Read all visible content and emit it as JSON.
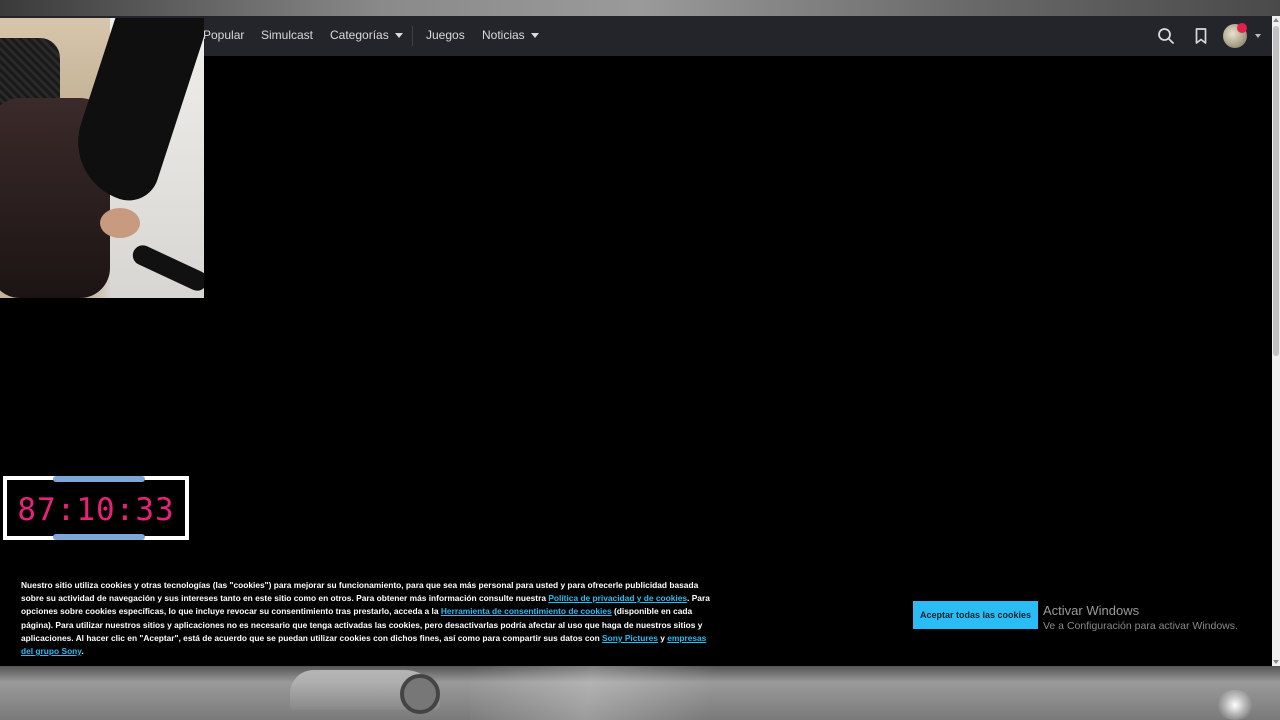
{
  "nav": {
    "items": [
      {
        "label": "Popular"
      },
      {
        "label": "Simulcast"
      },
      {
        "label": "Categorías"
      },
      {
        "label": "Juegos"
      },
      {
        "label": "Noticias"
      }
    ],
    "icons": [
      "search-icon",
      "bookmark-icon",
      "avatar"
    ]
  },
  "timer": {
    "display": "87:10:33"
  },
  "cookie_banner": {
    "text_1": "Nuestro sitio utiliza cookies y otras tecnologías (las \"cookies\") para mejorar su funcionamiento, para que sea más personal para usted y para ofrecerle publicidad basada sobre su actividad de navegación y sus intereses tanto en este sitio como en otros. Para obtener más información consulte nuestra ",
    "link_privacy": "Política de privacidad y de cookies",
    "text_2": ". Para opciones sobre cookies específicas, lo que incluye revocar su consentimiento tras prestarlo, acceda a la ",
    "link_tool": "Herramienta de consentimiento de cookies",
    "text_3": " (disponible en cada página). Para utilizar nuestros sitios y aplicaciones no es necesario que tenga activadas las cookies, pero desactivarlas podría afectar al uso que haga de nuestros sitios y aplicaciones. Al hacer clic en \"Aceptar\", está de acuerdo que se puedan utilizar cookies con dichos fines, así como para compartir sus datos con ",
    "link_sony": "Sony Pictures",
    "text_4": " y ",
    "link_group": "empresas del grupo Sony",
    "text_5": ".",
    "accept_label": "Aceptar todas las cookies"
  },
  "windows_watermark": {
    "title": "Activar Windows",
    "subtitle": "Ve a Configuración para activar Windows."
  },
  "colors": {
    "accent": "#2abdf5",
    "timer": "#e8217a",
    "navbar": "#23252b"
  }
}
